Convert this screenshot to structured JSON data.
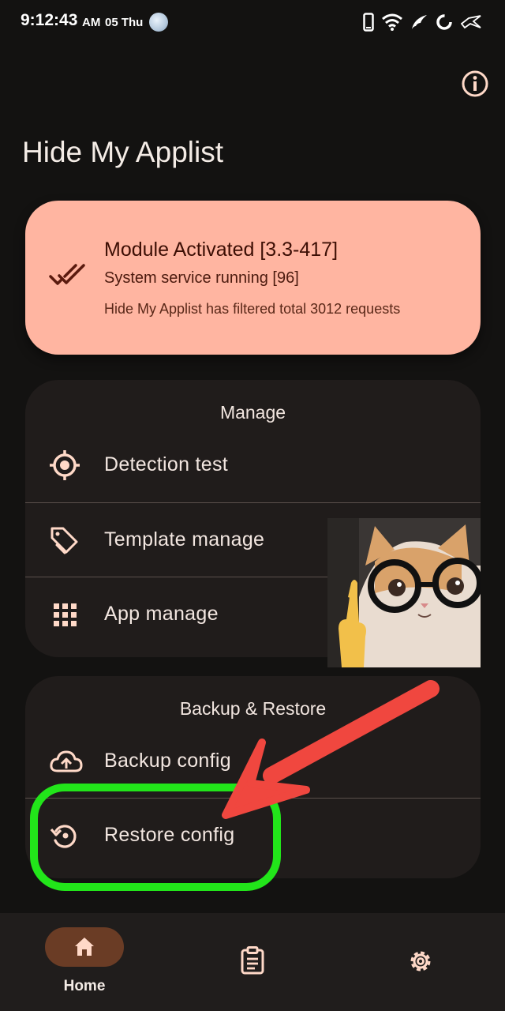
{
  "status_bar": {
    "time": "9:12:43",
    "ampm": "AM",
    "date": "05 Thu",
    "icons": [
      "phone-icon",
      "wifi-icon",
      "wing-icon",
      "ring-icon",
      "rog-logo-icon"
    ]
  },
  "header": {
    "title": "Hide My Applist",
    "info_icon": "info-icon"
  },
  "status_card": {
    "title": "Module Activated [3.3-417]",
    "subtitle": "System service running [96]",
    "description": "Hide My Applist has filtered total 3012 requests",
    "icon": "double-check-icon",
    "color": "#ffb5a1"
  },
  "manage": {
    "title": "Manage",
    "items": [
      {
        "label": "Detection test",
        "icon": "target-icon"
      },
      {
        "label": "Template manage",
        "icon": "tag-icon"
      },
      {
        "label": "App manage",
        "icon": "grid-icon"
      }
    ]
  },
  "backup": {
    "title": "Backup & Restore",
    "items": [
      {
        "label": "Backup config",
        "icon": "cloud-upload-icon"
      },
      {
        "label": "Restore config",
        "icon": "restore-icon"
      }
    ]
  },
  "nav": {
    "items": [
      {
        "label": "Home",
        "icon": "home-icon",
        "active": true
      },
      {
        "label": "",
        "icon": "clipboard-icon",
        "active": false
      },
      {
        "label": "",
        "icon": "settings-icon",
        "active": false
      }
    ]
  },
  "colors": {
    "background": "#131211",
    "card": "#201c1b",
    "accent": "#ffb5a1",
    "icon": "#ffd9c8",
    "highlight": "#22e51a",
    "arrow": "#f0473f"
  }
}
